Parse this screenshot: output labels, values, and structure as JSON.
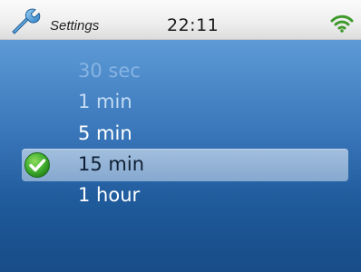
{
  "header": {
    "title": "Settings",
    "time": "22:11",
    "left_icon": "wrench-icon",
    "right_icon": "wifi-icon"
  },
  "list": {
    "selected_index": 3,
    "items": [
      {
        "label": "30 sec"
      },
      {
        "label": "1 min"
      },
      {
        "label": "5 min"
      },
      {
        "label": "15 min"
      },
      {
        "label": "1 hour"
      }
    ]
  },
  "colors": {
    "accent_selected_bg": "#93b3d8",
    "check_green": "#3fae2e",
    "background_blue": "#2e6aab"
  }
}
